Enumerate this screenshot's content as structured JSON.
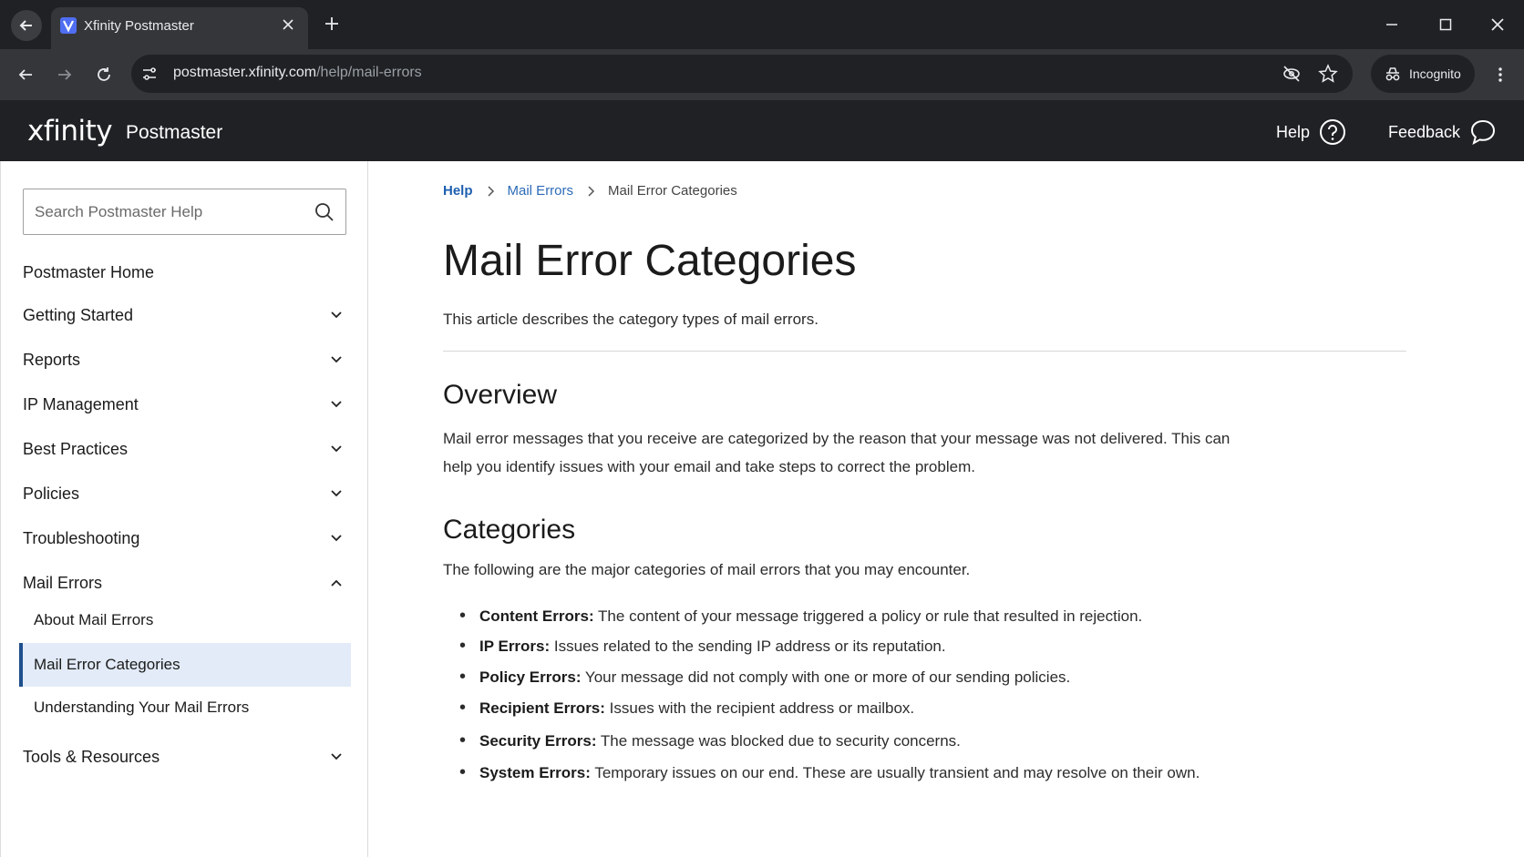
{
  "browser": {
    "tab_title": "Xfinity Postmaster",
    "url_host": "postmaster.xfinity.com",
    "url_path": "/help/mail-errors",
    "incognito_label": "Incognito"
  },
  "header": {
    "logo": "xfinity",
    "product": "Postmaster",
    "help_label": "Help",
    "feedback_label": "Feedback"
  },
  "sidebar": {
    "search_placeholder": "Search Postmaster Help",
    "items": [
      {
        "label": "Postmaster Home",
        "expandable": false
      },
      {
        "label": "Getting Started",
        "expandable": true,
        "expanded": false
      },
      {
        "label": "Reports",
        "expandable": true,
        "expanded": false
      },
      {
        "label": "IP Management",
        "expandable": true,
        "expanded": false
      },
      {
        "label": "Best Practices",
        "expandable": true,
        "expanded": false
      },
      {
        "label": "Policies",
        "expandable": true,
        "expanded": false
      },
      {
        "label": "Troubleshooting",
        "expandable": true,
        "expanded": false
      },
      {
        "label": "Mail Errors",
        "expandable": true,
        "expanded": true
      },
      {
        "label": "Tools & Resources",
        "expandable": true,
        "expanded": false
      }
    ],
    "mail_errors_children": [
      {
        "label": "About Mail Errors",
        "active": false
      },
      {
        "label": "Mail Error Categories",
        "active": true
      },
      {
        "label": "Understanding Your Mail Errors",
        "active": false
      }
    ]
  },
  "content": {
    "breadcrumb": [
      "Help",
      "Mail Errors",
      "Mail Error Categories"
    ],
    "title": "Mail Error Categories",
    "intro": "This article describes the category types of mail errors.",
    "overview_heading": "Overview",
    "overview_text": "Mail error messages that you receive are categorized by the reason that your message was not delivered. This can help you identify issues with your email and take steps to correct the problem.",
    "categories_heading": "Categories",
    "categories_intro": "The following are the major categories of mail errors that you may encounter.",
    "categories": [
      {
        "name": "Content Errors:",
        "desc": "The content of your message triggered a policy or rule that resulted in rejection."
      },
      {
        "name": "IP Errors:",
        "desc": "Issues related to the sending IP address or its reputation."
      },
      {
        "name": "Policy Errors:",
        "desc": "Your message did not comply with one or more of our sending policies."
      },
      {
        "name": "Recipient Errors:",
        "desc": "Issues with the recipient address or mailbox."
      },
      {
        "name": "Security Errors:",
        "desc": "The message was blocked due to security concerns."
      },
      {
        "name": "System Errors:",
        "desc": "Temporary issues on our end. These are usually transient and may resolve on their own."
      }
    ]
  },
  "colors": {
    "header_bg": "#1f2125",
    "link": "#2d6bb8",
    "active_bg": "#e2ebf7",
    "active_border": "#1e4f8c"
  }
}
